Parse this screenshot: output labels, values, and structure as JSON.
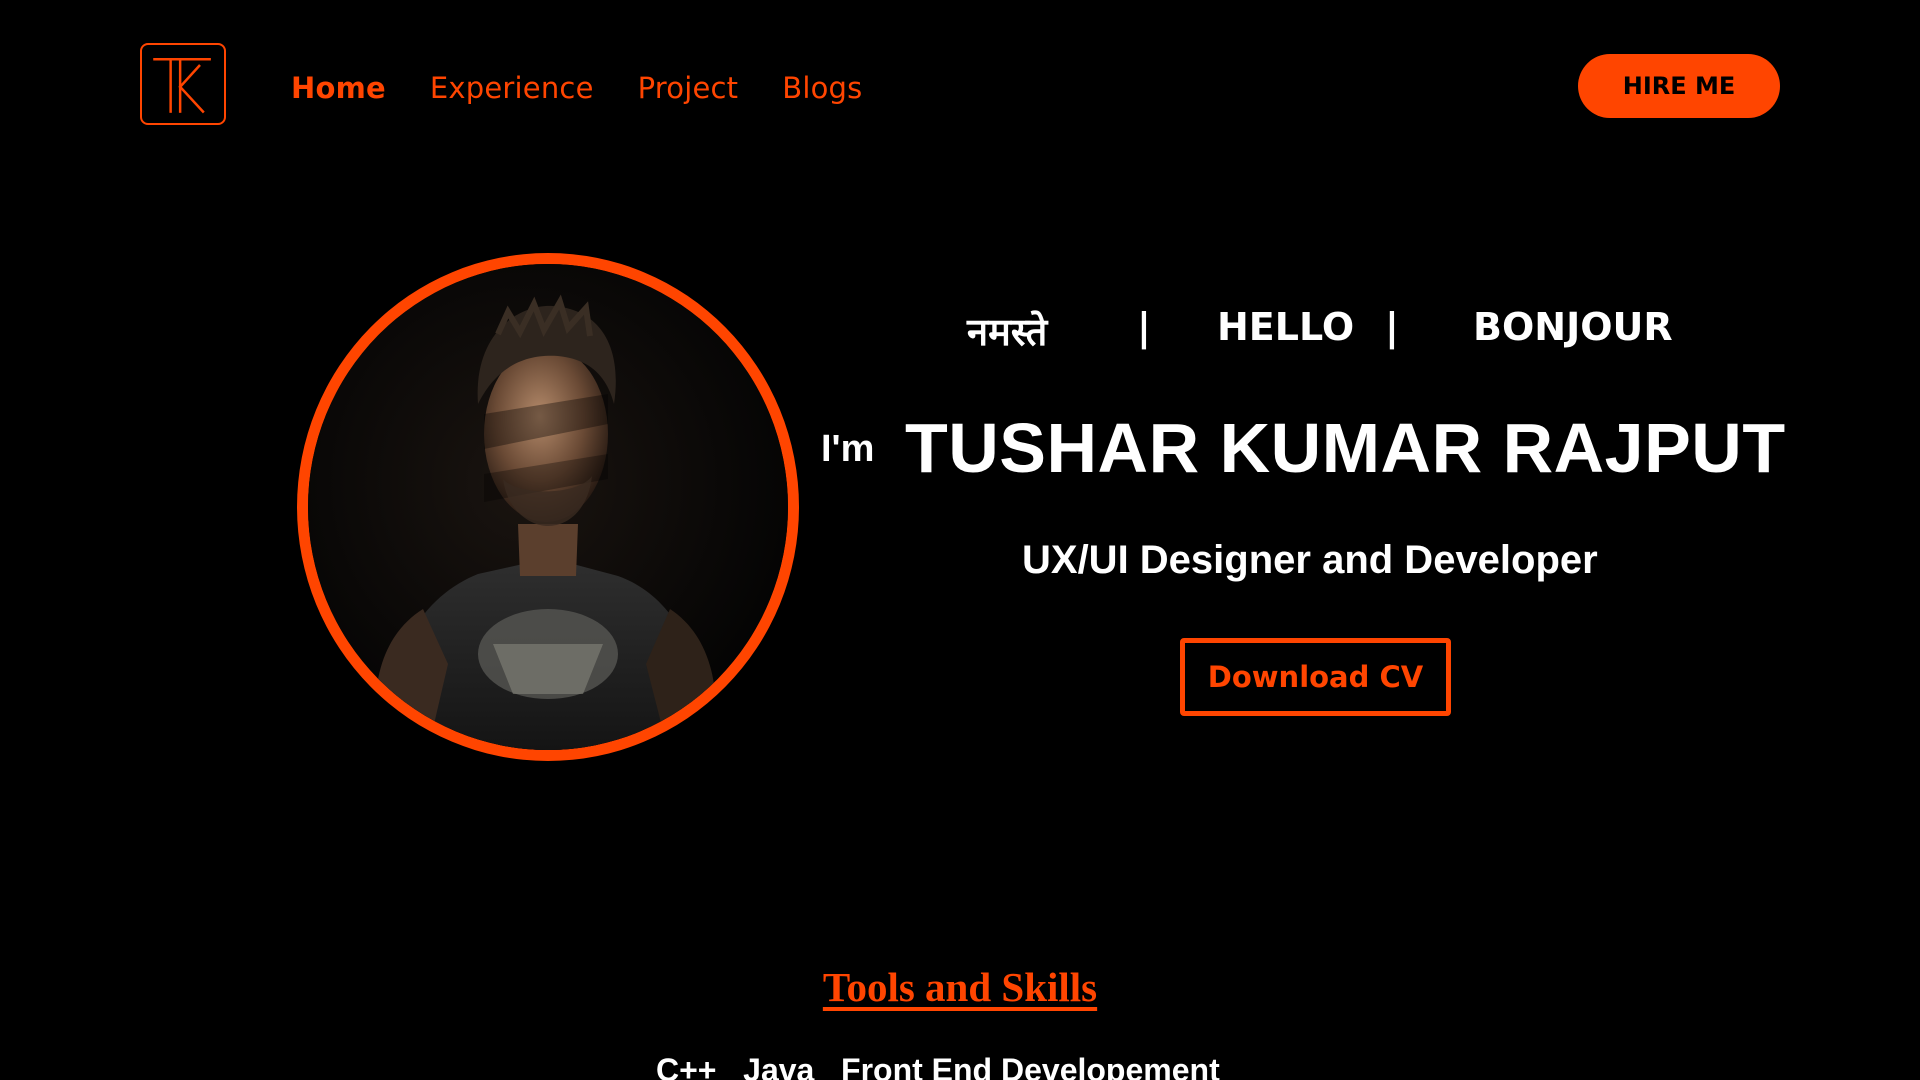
{
  "colors": {
    "accent": "#ff4500",
    "background": "#000000",
    "text": "#ffffff"
  },
  "header": {
    "logo_icon": "tk-monogram-logo",
    "nav": [
      {
        "label": "Home",
        "active": true
      },
      {
        "label": "Experience",
        "active": false
      },
      {
        "label": "Project",
        "active": false
      },
      {
        "label": "Blogs",
        "active": false
      }
    ],
    "hire_label": "HIRE ME"
  },
  "hero": {
    "greetings": [
      "नमस्ते",
      "HELLO",
      "BONJOUR"
    ],
    "separator": "|",
    "intro": "I'm",
    "name": "TUSHAR KUMAR RAJPUT",
    "role": "UX/UI Designer and Developer",
    "cv_label": "Download CV",
    "profile_photo": "profile-photo"
  },
  "skills": {
    "title": "Tools and Skills",
    "list": "C++   Java   Front End Developement"
  }
}
